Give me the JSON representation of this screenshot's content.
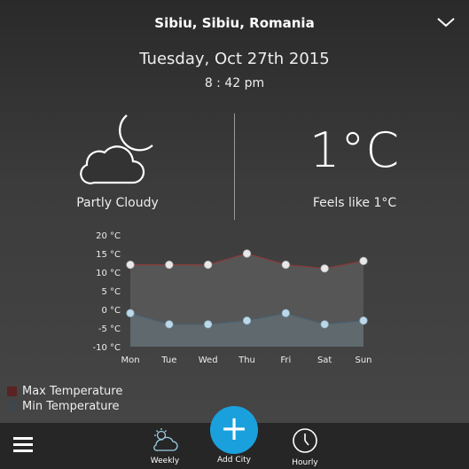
{
  "header": {
    "location": "Sibiu, Sibiu, Romania",
    "date": "Tuesday, Oct 27th 2015",
    "time": "8 : 42 pm"
  },
  "current": {
    "condition": "Partly Cloudy",
    "condition_icon": "partly-cloudy-night-icon",
    "temperature": "1°C",
    "feels_like": "Feels like 1°C"
  },
  "chart_data": {
    "type": "area",
    "categories": [
      "Mon",
      "Tue",
      "Wed",
      "Thu",
      "Fri",
      "Sat",
      "Sun"
    ],
    "y_tick_labels": [
      "20 °C",
      "15 °C",
      "10 °C",
      "5 °C",
      "0 °C",
      "-5 °C",
      "-10 °C"
    ],
    "ylim": [
      -10,
      20
    ],
    "series": [
      {
        "name": "Max Temperature",
        "values": [
          12,
          12,
          12,
          15,
          12,
          11,
          13
        ],
        "color": "#8a2a2a"
      },
      {
        "name": "Min Temperature",
        "values": [
          -1,
          -4,
          -4,
          -3,
          -1,
          -4,
          -3
        ],
        "color": "#3f474d"
      }
    ],
    "legend_position": "bottom-left",
    "grid": false
  },
  "bottom_nav": {
    "menu_icon": "hamburger-menu-icon",
    "weekly_label": "Weekly",
    "add_city_label": "Add City",
    "hourly_label": "Hourly"
  },
  "colors": {
    "accent": "#1aa0dc",
    "max_fill": "#5a5a5a",
    "min_fill": "#606a70",
    "max_line": "#8a3a3a",
    "min_line": "#4a6070"
  }
}
